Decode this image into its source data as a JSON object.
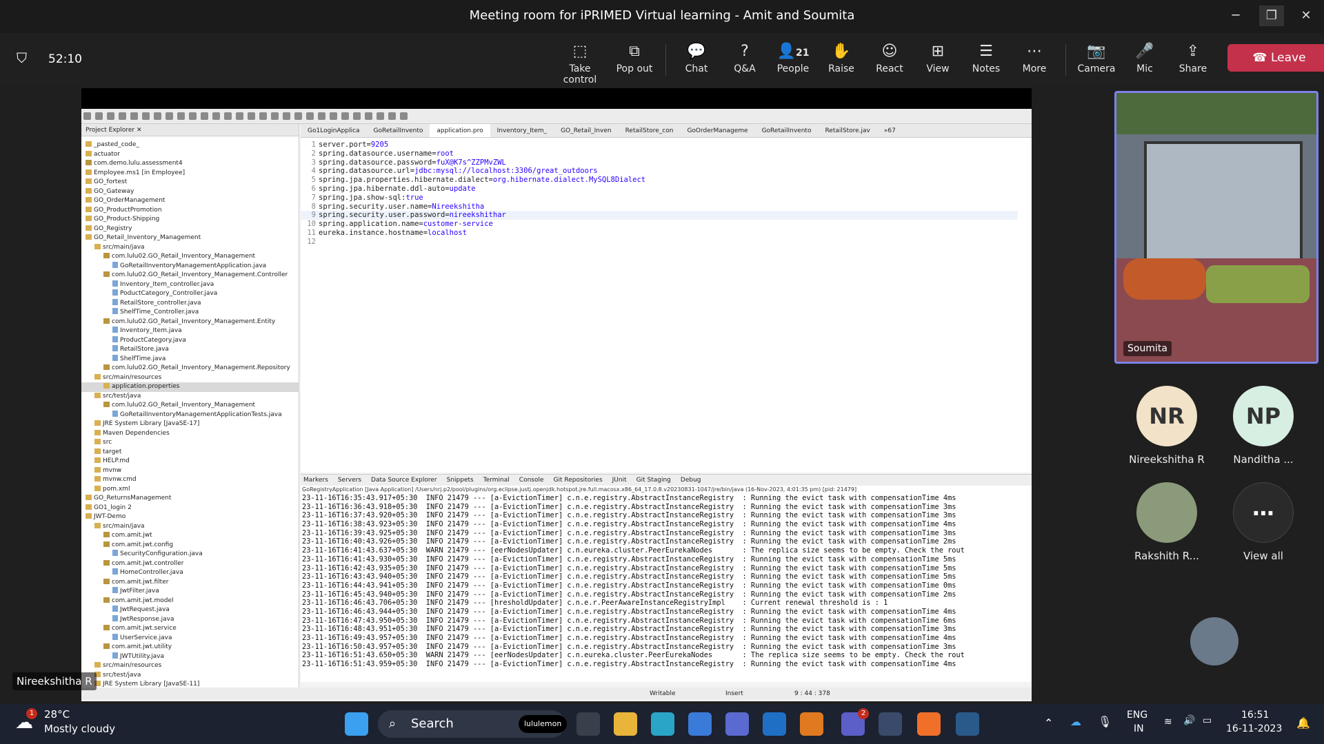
{
  "window": {
    "title": "Meeting room for iPRIMED Virtual learning - Amit and Soumita",
    "timer": "52:10"
  },
  "toolbar": {
    "take_control": "Take control",
    "pop_out": "Pop out",
    "chat": "Chat",
    "qa": "Q&A",
    "people": "People",
    "people_count": "21",
    "raise": "Raise",
    "react": "React",
    "view": "View",
    "notes": "Notes",
    "more": "More",
    "camera": "Camera",
    "mic": "Mic",
    "share": "Share",
    "leave": "Leave"
  },
  "eclipse": {
    "project_explorer": "Project Explorer",
    "tree": [
      "_pasted_code_",
      "actuator",
      "com.demo.lulu.assessment4",
      "Employee.ms1 [in Employee]",
      "GO_fortest",
      "GO_Gateway",
      "GO_OrderManagement",
      "GO_ProductPromotion",
      "GO_Product-Shipping",
      "GO_Registry",
      "GO_Retail_Inventory_Management",
      "src/main/java",
      "com.lulu02.GO_Retail_Inventory_Management",
      "GoRetailInventoryManagementApplication.java",
      "com.lulu02.GO_Retail_Inventory_Management.Controller",
      "Inventory_Item_controller.java",
      "PoductCategory_Controller.java",
      "RetailStore_controller.java",
      "ShelfTime_Controller.java",
      "com.lulu02.GO_Retail_Inventory_Management.Entity",
      "Inventory_Item.java",
      "ProductCategory.java",
      "RetailStore.java",
      "ShelfTime.java",
      "com.lulu02.GO_Retail_Inventory_Management.Repository",
      "src/main/resources",
      "application.properties",
      "src/test/java",
      "com.lulu02.GO_Retail_Inventory_Management",
      "GoRetailInventoryManagementApplicationTests.java",
      "JRE System Library [JavaSE-17]",
      "Maven Dependencies",
      "src",
      "target",
      "HELP.md",
      "mvnw",
      "mvnw.cmd",
      "pom.xml",
      "GO_ReturnsManagement",
      "GO1_login 2",
      "JWT-Demo",
      "src/main/java",
      "com.amit.jwt",
      "com.amit.jwt.config",
      "SecurityConfiguration.java",
      "com.amit.jwt.controller",
      "HomeController.java",
      "com.amit.jwt.filter",
      "JwtFilter.java",
      "com.amit.jwt.model",
      "JwtRequest.java",
      "JwtResponse.java",
      "com.amit.jwt.service",
      "UserService.java",
      "com.amit.jwt.utility",
      "JWTUtility.java",
      "src/main/resources",
      "src/test/java",
      "JRE System Library [JavaSE-11]"
    ],
    "tabs": [
      "Go1LoginApplica",
      "GoRetailInvento",
      "application.pro",
      "Inventory_Item_",
      "GO_Retail_Inven",
      "RetailStore_con",
      "GoOrderManageme",
      "GoRetailInvento",
      "RetailStore.jav",
      "»67"
    ],
    "code": [
      [
        "server.port=",
        "9205"
      ],
      [
        "spring.datasource.username=",
        "root"
      ],
      [
        "spring.datasource.password=",
        "fuX@K7s^ZZPMvZWL"
      ],
      [
        "spring.datasource.url=",
        "jdbc:mysql://localhost:3306/great_outdoors"
      ],
      [
        "spring.jpa.properties.hibernate.dialect=",
        "org.hibernate.dialect.MySQL8Dialect"
      ],
      [
        "spring.jpa.hibernate.ddl-auto=",
        "update"
      ],
      [
        "spring.jpa.show-sql:",
        "true"
      ],
      [
        "spring.security.user.name=",
        "Nireekshitha"
      ],
      [
        "spring.security.user.password=",
        "nireekshithar"
      ],
      [
        "spring.application.name=",
        "customer-service"
      ],
      [
        "eureka.instance.hostname=",
        "localhost"
      ],
      [
        "",
        ""
      ]
    ],
    "console_tabs": [
      "Markers",
      "Servers",
      "Data Source Explorer",
      "Snippets",
      "Terminal",
      "Console",
      "Git Repositories",
      "JUnit",
      "Git Staging",
      "Debug"
    ],
    "console_path": "GoRegistryApplication [Java Application] /Users/nrj.p2/pool/plugins/org.eclipse.justj.openjdk.hotspot.jre.full.macosx.x86_64_17.0.8.v20230831-1047/jre/bin/java  (16-Nov-2023, 4:01:35 pm) [pid: 21479]",
    "log": [
      "23-11-16T16:35:43.917+05:30  INFO 21479 --- [a-EvictionTimer] c.n.e.registry.AbstractInstanceRegistry  : Running the evict task with compensationTime 4ms",
      "23-11-16T16:36:43.918+05:30  INFO 21479 --- [a-EvictionTimer] c.n.e.registry.AbstractInstanceRegistry  : Running the evict task with compensationTime 3ms",
      "23-11-16T16:37:43.920+05:30  INFO 21479 --- [a-EvictionTimer] c.n.e.registry.AbstractInstanceRegistry  : Running the evict task with compensationTime 3ms",
      "23-11-16T16:38:43.923+05:30  INFO 21479 --- [a-EvictionTimer] c.n.e.registry.AbstractInstanceRegistry  : Running the evict task with compensationTime 4ms",
      "23-11-16T16:39:43.925+05:30  INFO 21479 --- [a-EvictionTimer] c.n.e.registry.AbstractInstanceRegistry  : Running the evict task with compensationTime 3ms",
      "23-11-16T16:40:43.926+05:30  INFO 21479 --- [a-EvictionTimer] c.n.e.registry.AbstractInstanceRegistry  : Running the evict task with compensationTime 2ms",
      "23-11-16T16:41:43.637+05:30  WARN 21479 --- [eerNodesUpdater] c.n.eureka.cluster.PeerEurekaNodes       : The replica size seems to be empty. Check the rout",
      "23-11-16T16:41:43.930+05:30  INFO 21479 --- [a-EvictionTimer] c.n.e.registry.AbstractInstanceRegistry  : Running the evict task with compensationTime 5ms",
      "23-11-16T16:42:43.935+05:30  INFO 21479 --- [a-EvictionTimer] c.n.e.registry.AbstractInstanceRegistry  : Running the evict task with compensationTime 5ms",
      "23-11-16T16:43:43.940+05:30  INFO 21479 --- [a-EvictionTimer] c.n.e.registry.AbstractInstanceRegistry  : Running the evict task with compensationTime 5ms",
      "23-11-16T16:44:43.941+05:30  INFO 21479 --- [a-EvictionTimer] c.n.e.registry.AbstractInstanceRegistry  : Running the evict task with compensationTime 0ms",
      "23-11-16T16:45:43.940+05:30  INFO 21479 --- [a-EvictionTimer] c.n.e.registry.AbstractInstanceRegistry  : Running the evict task with compensationTime 2ms",
      "23-11-16T16:46:43.706+05:30  INFO 21479 --- [hresholdUpdater] c.n.e.r.PeerAwareInstanceRegistryImpl    : Current renewal threshold is : 1",
      "23-11-16T16:46:43.944+05:30  INFO 21479 --- [a-EvictionTimer] c.n.e.registry.AbstractInstanceRegistry  : Running the evict task with compensationTime 4ms",
      "23-11-16T16:47:43.950+05:30  INFO 21479 --- [a-EvictionTimer] c.n.e.registry.AbstractInstanceRegistry  : Running the evict task with compensationTime 6ms",
      "23-11-16T16:48:43.951+05:30  INFO 21479 --- [a-EvictionTimer] c.n.e.registry.AbstractInstanceRegistry  : Running the evict task with compensationTime 3ms",
      "23-11-16T16:49:43.957+05:30  INFO 21479 --- [a-EvictionTimer] c.n.e.registry.AbstractInstanceRegistry  : Running the evict task with compensationTime 4ms",
      "23-11-16T16:50:43.957+05:30  INFO 21479 --- [a-EvictionTimer] c.n.e.registry.AbstractInstanceRegistry  : Running the evict task with compensationTime 3ms",
      "23-11-16T16:51:43.650+05:30  WARN 21479 --- [eerNodesUpdater] c.n.eureka.cluster.PeerEurekaNodes       : The replica size seems to be empty. Check the rout",
      "23-11-16T16:51:43.959+05:30  INFO 21479 --- [a-EvictionTimer] c.n.e.registry.AbstractInstanceRegistry  : Running the evict task with compensationTime 4ms"
    ],
    "status": {
      "writable": "Writable",
      "insert": "Insert",
      "position": "9 : 44 : 378"
    }
  },
  "participants": {
    "video_name": "Soumita",
    "list": [
      {
        "initials": "NR",
        "name": "Nireekshitha R",
        "color": "#f2e2c8"
      },
      {
        "initials": "NP",
        "name": "Nanditha ...",
        "color": "#d7eee2"
      },
      {
        "initials": "",
        "name": "Rakshith R...",
        "color": "#8a9a7a"
      },
      {
        "initials": "",
        "name": "View all",
        "color": "#2a2a2a"
      }
    ],
    "presenter_tag": "Nireekshitha R"
  },
  "taskbar": {
    "weather_temp": "28°C",
    "weather_desc": "Mostly cloudy",
    "weather_badge": "1",
    "search": "Search",
    "search_chip": "lululemon",
    "teams_badge": "2",
    "lang": "ENG",
    "region": "IN",
    "time": "16:51",
    "date": "16-11-2023"
  }
}
